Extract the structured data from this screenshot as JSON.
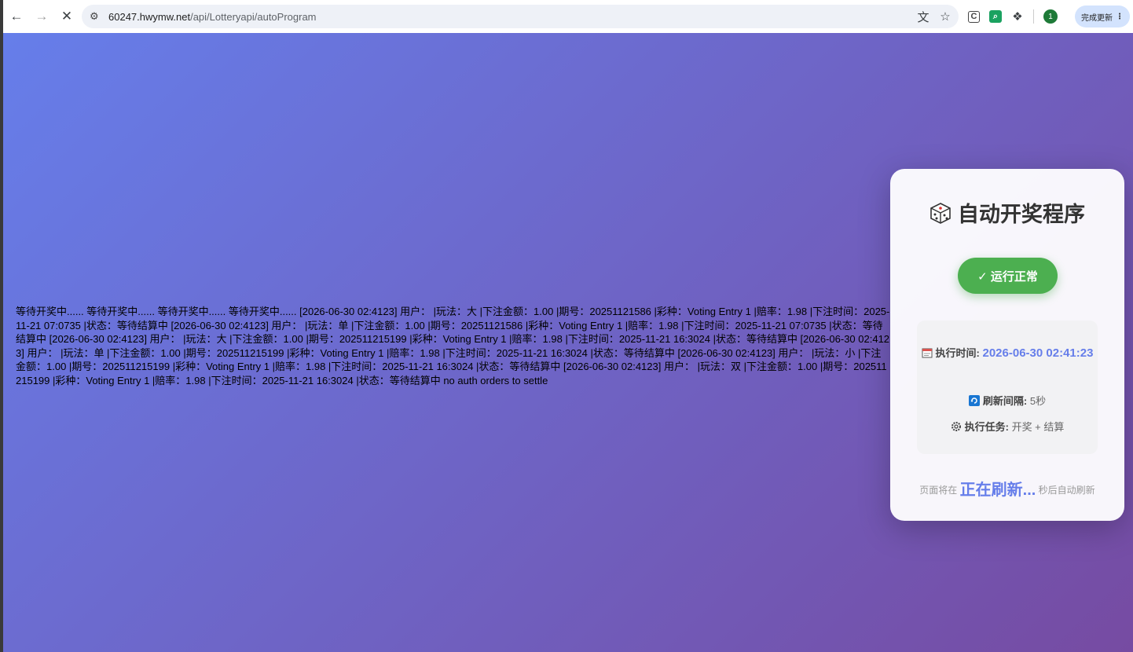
{
  "browser": {
    "url_host": "60247.hwymw.net",
    "url_path": "/api/Lotteryapi/autoProgram",
    "update_button": "完成更新",
    "profile_initial": "1",
    "icons": [
      "back-icon",
      "forward-icon",
      "stop-icon",
      "site-settings-icon",
      "translate-icon",
      "bookmark-star-icon",
      "extension-c-icon",
      "extension-search-icon",
      "extensions-puzzle-icon",
      "more-menu-icon"
    ]
  },
  "log": {
    "text": "等待开奖中...... 等待开奖中...... 等待开奖中...... 等待开奖中...... [2026-06-30 02:4123] 用户： |玩法：大 |下注金额：1.00 |期号：20251121586 |彩种：Voting Entry 1 |赔率：1.98 |下注时间：2025-11-21 07:0735 |状态：等待结算中 [2026-06-30 02:4123] 用户： |玩法：单 |下注金额：1.00 |期号：20251121586 |彩种：Voting Entry 1 |赔率：1.98 |下注时间：2025-11-21 07:0735 |状态：等待结算中 [2026-06-30 02:4123] 用户： |玩法：大 |下注金额：1.00 |期号：202511215199 |彩种：Voting Entry 1 |赔率：1.98 |下注时间：2025-11-21 16:3024 |状态：等待结算中 [2026-06-30 02:4123] 用户： |玩法：单 |下注金额：1.00 |期号：202511215199 |彩种：Voting Entry 1 |赔率：1.98 |下注时间：2025-11-21 16:3024 |状态：等待结算中 [2026-06-30 02:4123] 用户： |玩法：小 |下注金额：1.00 |期号：202511215199 |彩种：Voting Entry 1 |赔率：1.98 |下注时间：2025-11-21 16:3024 |状态：等待结算中 [2026-06-30 02:4123] 用户： |玩法：双 |下注金额：1.00 |期号：202511215199 |彩种：Voting Entry 1 |赔率：1.98 |下注时间：2025-11-21 16:3024 |状态：等待结算中 no auth orders to settle"
  },
  "card": {
    "title": "自动开奖程序",
    "title_icon": "dice-icon",
    "status": "✓ 运行正常",
    "status_color": "#4caf50",
    "exec_time_label": "执行时间:",
    "exec_time_value": "2026-06-30 02:41:23",
    "interval_label": "刷新间隔:",
    "interval_value": "5秒",
    "task_label": "执行任务:",
    "task_value": "开奖 + 结算",
    "refresh_prefix": "页面将在",
    "refresh_countdown": "正在刷新...",
    "refresh_suffix": "秒后自动刷新",
    "accent_color": "#667eea"
  }
}
